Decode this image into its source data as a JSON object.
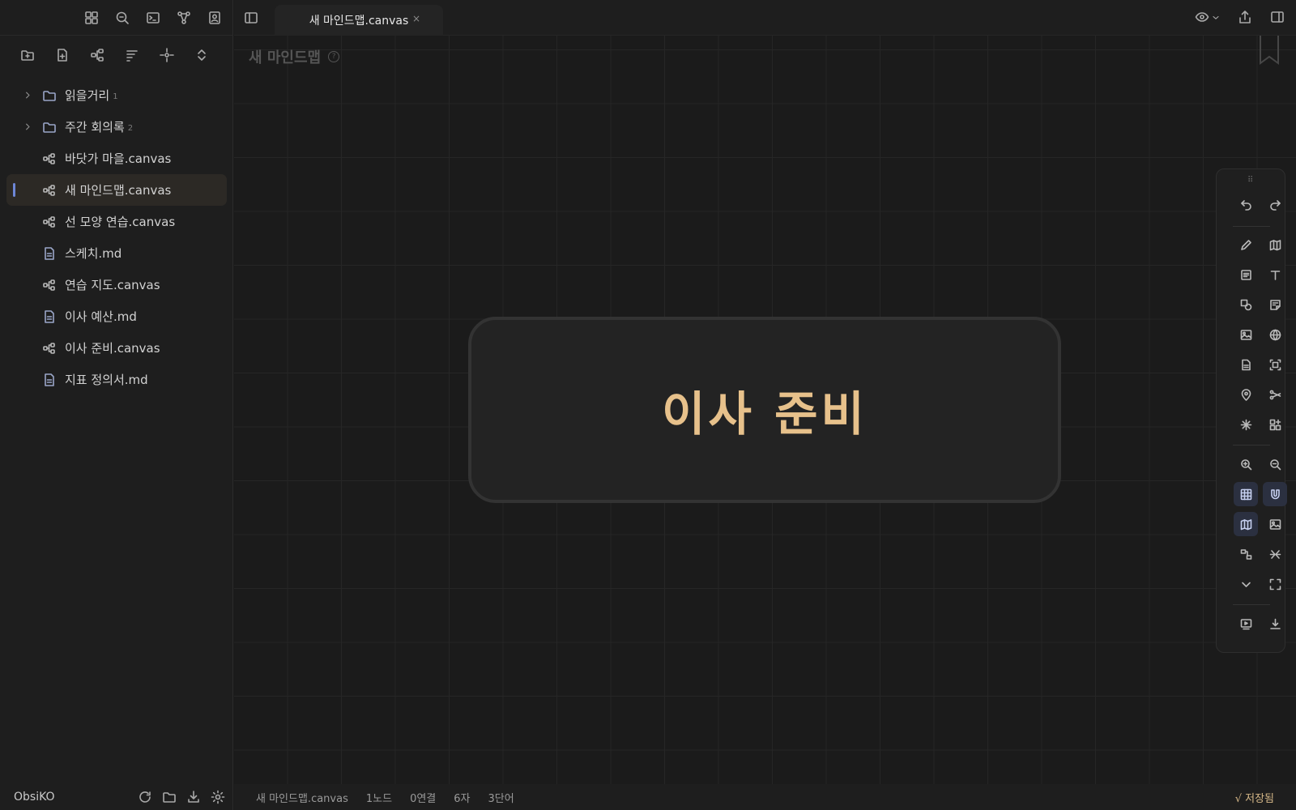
{
  "sidebar": {
    "ribbon_icons": [
      "grid-icon",
      "search-zoom-icon",
      "terminal-icon",
      "graph-icon",
      "profile-icon"
    ],
    "file_tools": [
      "new-folder-icon",
      "new-note-icon",
      "new-canvas-icon",
      "sort-icon",
      "locate-icon",
      "expand-collapse-icon"
    ],
    "tree": [
      {
        "type": "folder",
        "label": "읽을거리",
        "count": "1"
      },
      {
        "type": "folder",
        "label": "주간 회의록",
        "count": "2"
      },
      {
        "type": "canvas",
        "label": "바닷가 마을.canvas"
      },
      {
        "type": "canvas",
        "label": "새 마인드맵.canvas",
        "active": true
      },
      {
        "type": "canvas",
        "label": "선 모양 연습.canvas"
      },
      {
        "type": "md",
        "label": "스케치.md"
      },
      {
        "type": "canvas",
        "label": "연습 지도.canvas"
      },
      {
        "type": "md",
        "label": "이사 예산.md"
      },
      {
        "type": "canvas",
        "label": "이사 준비.canvas"
      },
      {
        "type": "md",
        "label": "지표 정의서.md"
      }
    ],
    "vault_name": "ObsiKO"
  },
  "tab": {
    "title": "새 마인드맵.canvas",
    "close": "×"
  },
  "canvas": {
    "title": "새 마인드맵",
    "help": "?",
    "node_text": "이사 준비",
    "node_color": "#e7c18b"
  },
  "status": {
    "file": "새 마인드맵.canvas",
    "nodes": "1노드",
    "edges": "0연결",
    "chars": "6자",
    "words": "3단어",
    "saved": "√ 저장됨"
  },
  "colors": {
    "accent": "#6d86d6",
    "node_text": "#e7c18b",
    "background": "#1b1b1b"
  }
}
